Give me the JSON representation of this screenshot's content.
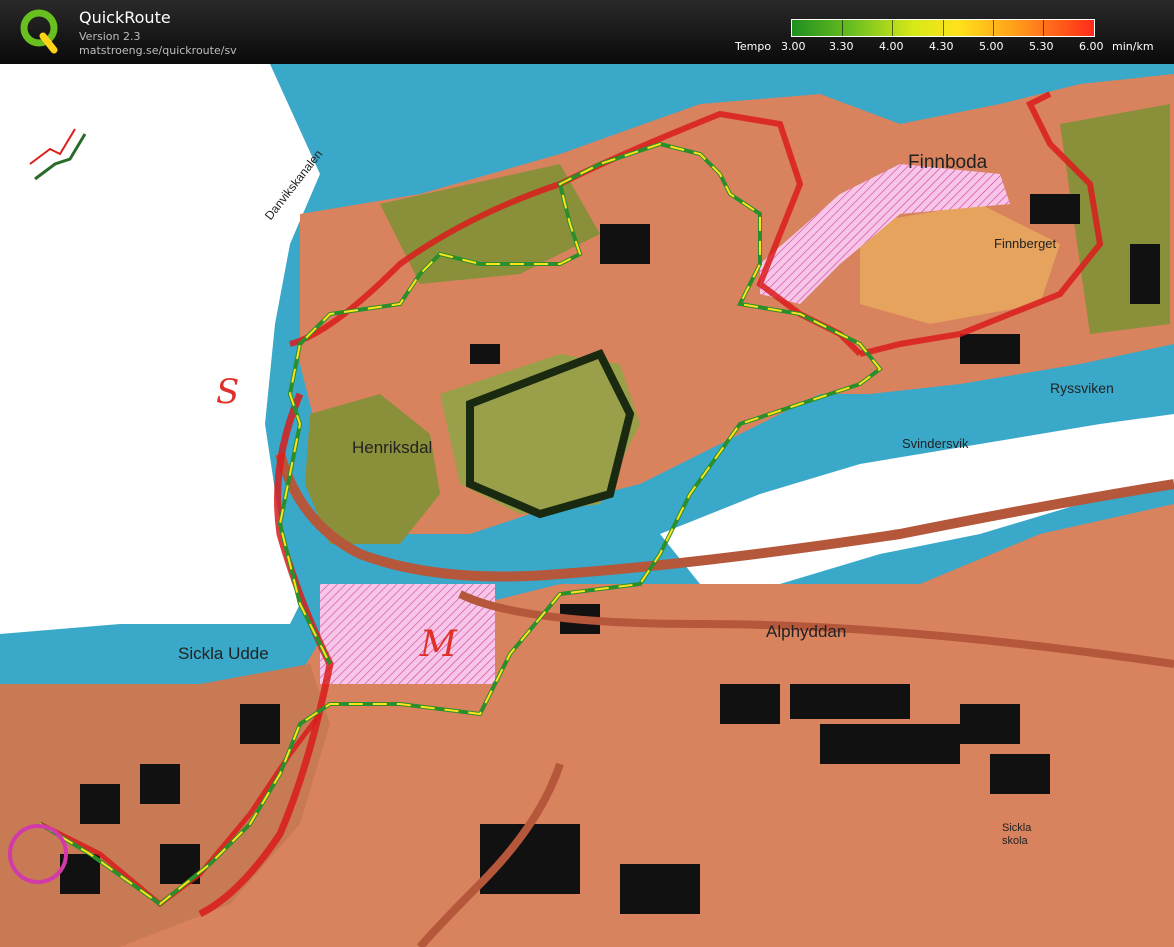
{
  "app": {
    "name": "QuickRoute",
    "version": "Version 2.3",
    "url": "matstroeng.se/quickroute/sv"
  },
  "legend": {
    "title": "Tempo",
    "unit": "min/km",
    "ticks": [
      "3.00",
      "3.30",
      "4.00",
      "4.30",
      "5.00",
      "5.30",
      "6.00"
    ],
    "colors": [
      "#1f8f1f",
      "#6abf20",
      "#d6e818",
      "#ffe21a",
      "#ff9a1a",
      "#ff2a1a"
    ]
  },
  "map": {
    "place_labels": [
      "Danvikskanalen",
      "Finnboda",
      "Finnberget",
      "Ryssviken",
      "Svindersvik",
      "Henriksdal",
      "Sickla Udde",
      "Alphyddan",
      "Sickla skola"
    ],
    "handwritten_marks": [
      "S",
      "M"
    ],
    "colors": {
      "water": "#3aa8c9",
      "paper": "#ffffff",
      "built_area": "#d9825e",
      "vegetation": "#8a8f3a",
      "building": "#111111",
      "out_of_bounds": "#f2a9d8",
      "route_outline": "#d91c1c",
      "gps_fast": "#2a8f2a",
      "gps_slow": "#ffe21a"
    }
  }
}
